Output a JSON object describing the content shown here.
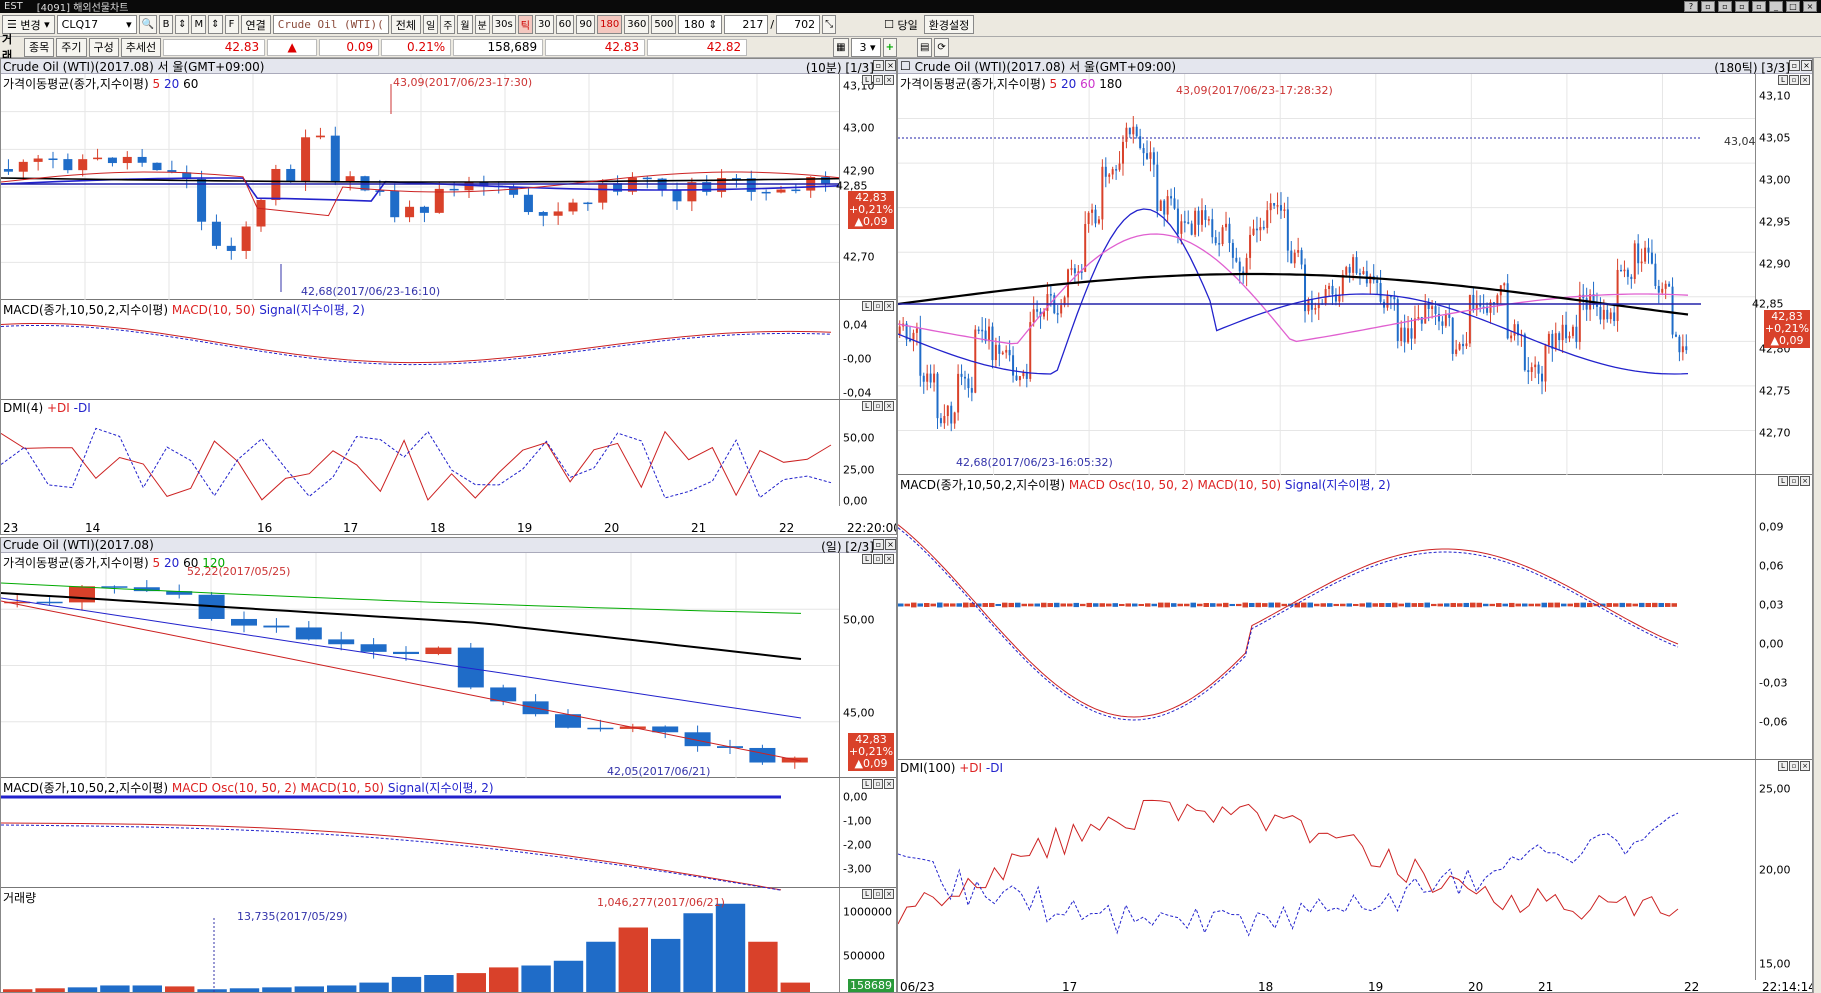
{
  "titlebar": {
    "left": "EST",
    "title": "[4091] 해외선물차트"
  },
  "toolbar": {
    "change_label": "변경",
    "symbol": "CLQ17",
    "product": "Crude Oil (WTI)(",
    "link_label": "연결",
    "all_label": "전체",
    "day": "일",
    "week": "주",
    "month": "월",
    "minute": "분",
    "sec30": "30s",
    "tick": "틱",
    "p30": "30",
    "p60": "60",
    "p90": "90",
    "p180": "180",
    "p360": "360",
    "p500": "500",
    "count": "180",
    "range_from": "217",
    "range_sep": "/",
    "range_to": "702",
    "today_label": "당일",
    "settings_label": "환경설정"
  },
  "quotebar": {
    "row_label": "거래",
    "item_label": "종목",
    "period_label": "주기",
    "compose_label": "구성",
    "trend_label": "추세선",
    "last": "42.83",
    "change": "0.09",
    "pct": "0.21%",
    "volume": "158,689",
    "bid": "42.83",
    "ask": "42.82",
    "layout_count": "3"
  },
  "left_top": {
    "title": "Crude Oil (WTI)(2017.08)   서  울(GMT+09:00)",
    "page": "(10분) [1/3]",
    "ma_label": "가격이동평균(종가,지수이평)",
    "ma_5": "5",
    "ma_20": "20",
    "ma_60": "60",
    "price_ticks": [
      "43,10",
      "43,00",
      "42,90",
      "42,70"
    ],
    "hi_ann": "43,09(2017/06/23-17:30)",
    "lo_ann": "42,68(2017/06/23-16:10)",
    "last_price": "42,85",
    "box": [
      "42,83",
      "+0,21%",
      "▲0,09"
    ],
    "macd_label": "MACD(종가,10,50,2,지수이평)",
    "macd_name": "MACD(10, 50)",
    "signal_name": "Signal(지수이평, 2)",
    "macd_ticks": [
      "0,04",
      "-0,00",
      "-0,04"
    ],
    "dmi_label": "DMI(4)",
    "dmi_plus": "+DI",
    "dmi_minus": "-DI",
    "dmi_ticks": [
      "50,00",
      "25,00",
      "0,00"
    ],
    "x_labels": [
      "23",
      "14",
      "16",
      "17",
      "18",
      "19",
      "20",
      "21",
      "22",
      "22:20:00"
    ]
  },
  "left_bottom": {
    "title": "Crude Oil (WTI)(2017.08)",
    "page": "(일) [2/3]",
    "ma_label": "가격이동평균(종가,지수이평)",
    "ma_5": "5",
    "ma_20": "20",
    "ma_60": "60",
    "ma_120": "120",
    "price_ticks": [
      "50,00",
      "45,00"
    ],
    "hi_ann": "52,22(2017/05/25)",
    "lo_ann": "42,05(2017/06/21)",
    "box": [
      "42,83",
      "+0,21%",
      "▲0,09"
    ],
    "macd_label": "MACD(종가,10,50,2,지수이평)",
    "osc_name": "MACD Osc(10, 50, 2)",
    "macd_name": "MACD(10, 50)",
    "signal_name": "Signal(지수이평, 2)",
    "macd_ticks": [
      "0,00",
      "-1,00",
      "-2,00",
      "-3,00"
    ],
    "vol_label": "거래량",
    "vol_ticks": [
      "1000000",
      "500000"
    ],
    "vol_ann": "1,046,277(2017/06/21)",
    "vol_ann2": "13,735(2017/05/29)",
    "vol_box": "158689",
    "volume_bars": [
      5,
      6,
      7,
      9,
      9,
      8,
      5,
      6,
      7,
      8,
      9,
      12,
      18,
      20,
      22,
      28,
      30,
      35,
      55,
      70,
      58,
      85,
      95,
      55,
      12
    ],
    "volume_colors": [
      "r",
      "r",
      "b",
      "b",
      "b",
      "r",
      "b",
      "b",
      "b",
      "b",
      "b",
      "b",
      "b",
      "b",
      "r",
      "r",
      "b",
      "b",
      "b",
      "r",
      "b",
      "b",
      "b",
      "r",
      "r"
    ]
  },
  "right": {
    "title": "Crude Oil (WTI)(2017.08)   서  울(GMT+09:00)",
    "page": "(180틱) [3/3]",
    "ma_label": "가격이동평균(종가,지수이평)",
    "ma_5": "5",
    "ma_20": "20",
    "ma_60": "60",
    "ma_180": "180",
    "price_ticks": [
      "43,10",
      "43,05",
      "43,00",
      "42,95",
      "42,90",
      "42,85",
      "42,80",
      "42,75",
      "42,70"
    ],
    "hi_ann": "43,09(2017/06/23-17:28:32)",
    "lo_ann": "42,68(2017/06/23-16:05:32)",
    "hline_label": "43,04",
    "last_price": "42,85",
    "box": [
      "42,83",
      "+0,21%",
      "▲0,09"
    ],
    "macd_label": "MACD(종가,10,50,2,지수이평)",
    "osc_name": "MACD Osc(10, 50, 2)",
    "macd_name": "MACD(10, 50)",
    "signal_name": "Signal(지수이평, 2)",
    "macd_ticks": [
      "0,09",
      "0,06",
      "0,03",
      "0,00",
      "-0,03",
      "-0,06"
    ],
    "dmi_label": "DMI(100)",
    "dmi_plus": "+DI",
    "dmi_minus": "-DI",
    "dmi_ticks": [
      "25,00",
      "20,00",
      "15,00"
    ],
    "x_labels": [
      "06/23",
      "17",
      "18",
      "19",
      "20",
      "21",
      "22",
      "22:14:14"
    ]
  },
  "colors": {
    "up": "#d9412a",
    "down": "#1f6cc8",
    "ma5": "#cc2222",
    "ma20": "#2222cc",
    "ma60": "#000000",
    "ma_pink": "#e060d0"
  }
}
